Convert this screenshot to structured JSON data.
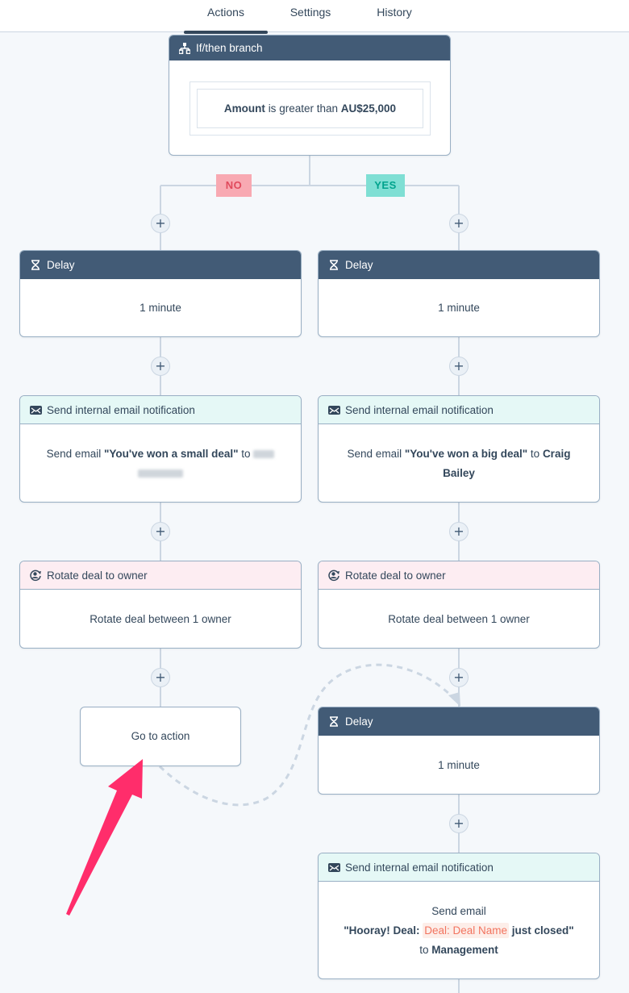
{
  "tabs": [
    {
      "label": "Actions",
      "active": true
    },
    {
      "label": "Settings",
      "active": false
    },
    {
      "label": "History",
      "active": false
    }
  ],
  "branch": {
    "title": "If/then branch",
    "icon": "branch-icon",
    "condition": {
      "property": "Amount",
      "operator": "is greater than",
      "value": "AU$25,000"
    },
    "no_label": "NO",
    "yes_label": "YES"
  },
  "add_action_symbol": "+",
  "no_branch": {
    "delay": {
      "title": "Delay",
      "icon": "hourglass-icon",
      "body": "1 minute"
    },
    "email": {
      "title": "Send internal email notification",
      "icon": "envelope-icon",
      "prefix": "Send email",
      "subject": "\"You've won a small deal\"",
      "to": "to",
      "recipient_redacted": true
    },
    "rotate": {
      "title": "Rotate deal to owner",
      "icon": "rotate-owner-icon",
      "body": "Rotate deal between 1 owner"
    },
    "goto": {
      "label": "Go to action"
    }
  },
  "yes_branch": {
    "delay": {
      "title": "Delay",
      "icon": "hourglass-icon",
      "body": "1 minute"
    },
    "email": {
      "title": "Send internal email notification",
      "icon": "envelope-icon",
      "prefix": "Send email",
      "subject": "\"You've won a big deal\"",
      "to": "to",
      "recipient": "Craig Bailey"
    },
    "rotate": {
      "title": "Rotate deal to owner",
      "icon": "rotate-owner-icon",
      "body": "Rotate deal between 1 owner"
    },
    "delay2": {
      "title": "Delay",
      "icon": "hourglass-icon",
      "body": "1 minute"
    },
    "email2": {
      "title": "Send internal email notification",
      "icon": "envelope-icon",
      "line1": "Send email",
      "subject_start": "\"Hooray! Deal:",
      "token": "Deal: Deal Name",
      "subject_end": "just closed\"",
      "to": "to",
      "recipient": "Management"
    }
  },
  "colors": {
    "header_dark": "#425b76",
    "header_mint": "#e5f8f6",
    "header_pink": "#fdedf2",
    "no_badge": "#f8a9b2",
    "yes_badge": "#7fdfd4",
    "token": "#f2745f",
    "annotation_arrow": "#ff2d6b"
  }
}
